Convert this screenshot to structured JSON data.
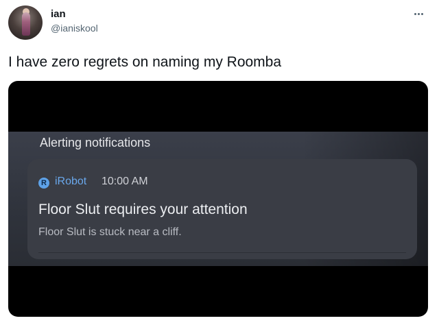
{
  "tweet": {
    "display_name": "ian",
    "handle": "@ianiskool",
    "text": "I have zero regrets on naming my Roomba",
    "more_icon": "more-horizontal-icon"
  },
  "notification_screenshot": {
    "section_title": "Alerting notifications",
    "app_icon": "irobot-logo-icon",
    "app_icon_glyph": "R",
    "app_name": "iRobot",
    "time": "10:00 AM",
    "title": "Floor Slut  requires your attention",
    "body": "Floor Slut  is stuck near a cliff.",
    "colors": {
      "app_accent": "#6aa8ec",
      "card_background": "#3a3d45"
    }
  }
}
